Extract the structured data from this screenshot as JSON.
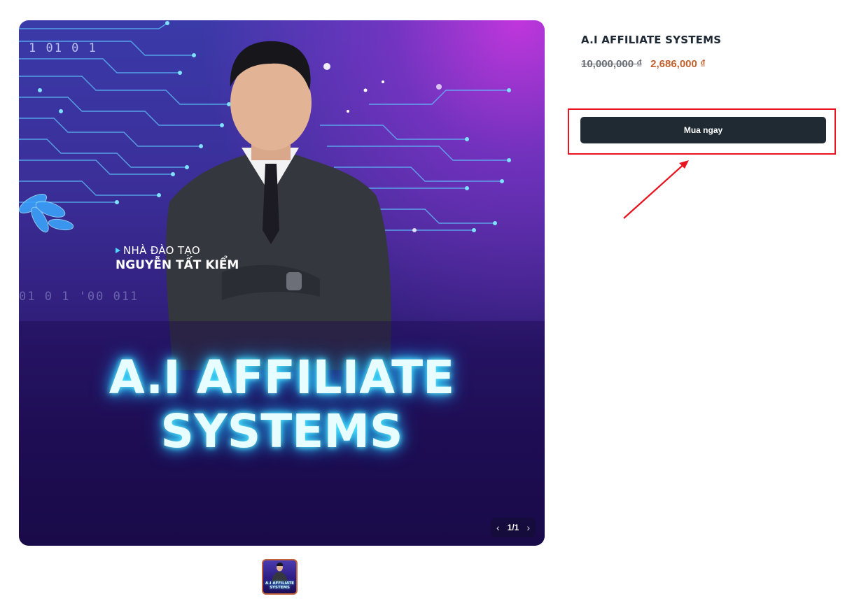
{
  "product": {
    "title": "A.I AFFILIATE SYSTEMS",
    "old_price": "10,000,000 ₫",
    "new_price": "2,686,000 ₫",
    "buy_label": "Mua ngay"
  },
  "gallery": {
    "image": {
      "trainer_role": "NHÀ ĐÀO TẠO",
      "trainer_name": "NGUYỄN TẤT KIỂM",
      "headline_line1": "A.I AFFILIATE",
      "headline_line2": "SYSTEMS",
      "binary_top": "1      01  0  1",
      "binary_mid": "01  0  1  '00  011"
    },
    "pager": {
      "text": "1/1",
      "prev_icon": "chevron-left-icon",
      "next_icon": "chevron-right-icon"
    },
    "thumbnails": [
      {
        "line1": "A.I AFFILIATE",
        "line2": "SYSTEMS",
        "selected": true
      }
    ]
  },
  "annotation": {
    "highlight_color": "#e8131f",
    "arrow_color": "#e8131f"
  },
  "colors": {
    "button_bg": "#1f2a33",
    "sale_price": "#c2612e",
    "old_price": "#6b6f76"
  }
}
